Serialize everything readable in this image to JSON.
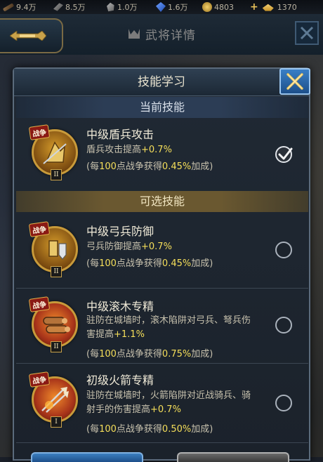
{
  "resources": {
    "wood": "9.4万",
    "iron": "8.5万",
    "stone": "1.0万",
    "gem": "1.6万",
    "coin": "4803",
    "gold": "1370",
    "add_symbol": "+"
  },
  "header": {
    "title": "武将详情"
  },
  "modal": {
    "title": "技能学习",
    "current_section": "当前技能",
    "optional_section": "可选技能"
  },
  "current_skill": {
    "tag": "战争",
    "level": "II",
    "name": "中级盾兵攻击",
    "desc": "盾兵攻击提高",
    "bonus": "+0.7%",
    "note_prefix": "(每",
    "note_num": "100",
    "note_mid": "点战争获得",
    "note_pct": "0.45%",
    "note_suffix": "加成)",
    "selected": true
  },
  "skills": [
    {
      "tag": "战争",
      "level": "II",
      "name": "中级弓兵防御",
      "desc": "弓兵防御提高",
      "bonus": "+0.7%",
      "note_prefix": "(每",
      "note_num": "100",
      "note_mid": "点战争获得",
      "note_pct": "0.45%",
      "note_suffix": "加成)",
      "selected": false
    },
    {
      "tag": "战争",
      "level": "II",
      "name": "中级滚木专精",
      "desc_line1": "驻防在城墙时，滚木陷阱对弓兵、弩兵伤",
      "desc_line2": "害提高",
      "bonus": "+1.1%",
      "note_prefix": "(每",
      "note_num": "100",
      "note_mid": "点战争获得",
      "note_pct": "0.75%",
      "note_suffix": "加成)",
      "selected": false
    },
    {
      "tag": "战争",
      "level": "I",
      "name": "初级火箭专精",
      "desc_line1": "驻防在城墙时，火箭陷阱对近战骑兵、骑",
      "desc_line2": "射手的伤害提高",
      "bonus": "+0.7%",
      "note_prefix": "(每",
      "note_num": "100",
      "note_mid": "点战争获得",
      "note_pct": "0.50%",
      "note_suffix": "加成)",
      "selected": false
    }
  ],
  "colors": {
    "bonus_yellow": "#f6df5a",
    "modal_close_blue": "#3a7fc6",
    "optional_bar_gold": "#6a5830"
  }
}
